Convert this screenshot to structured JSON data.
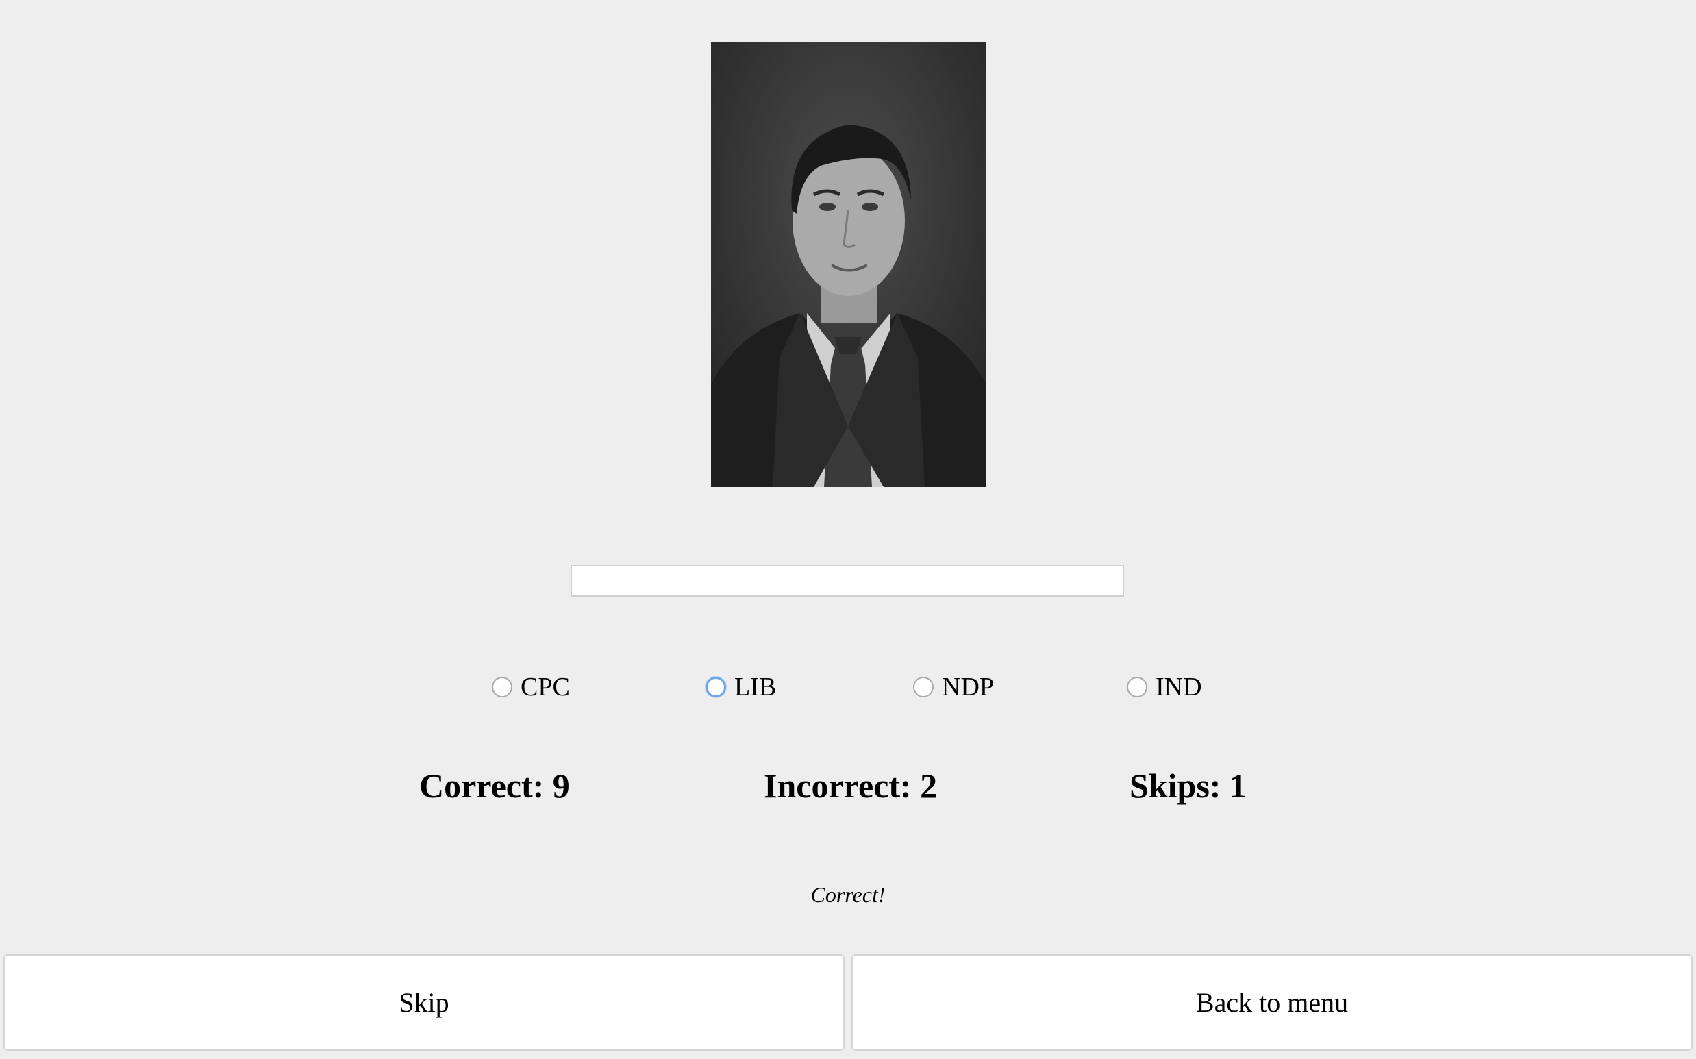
{
  "quiz": {
    "answer_input": {
      "value": "",
      "placeholder": ""
    },
    "parties": [
      {
        "label": "CPC",
        "selected": false
      },
      {
        "label": "LIB",
        "selected": false,
        "focused": true
      },
      {
        "label": "NDP",
        "selected": false
      },
      {
        "label": "IND",
        "selected": false
      }
    ],
    "score": {
      "correct": "Correct: 9",
      "incorrect": "Incorrect: 2",
      "skips": "Skips: 1"
    },
    "feedback": "Correct!",
    "buttons": {
      "skip": "Skip",
      "back": "Back to menu"
    }
  },
  "colors": {
    "background": "#eeeeee",
    "focus_ring": "#6ea6e8"
  }
}
